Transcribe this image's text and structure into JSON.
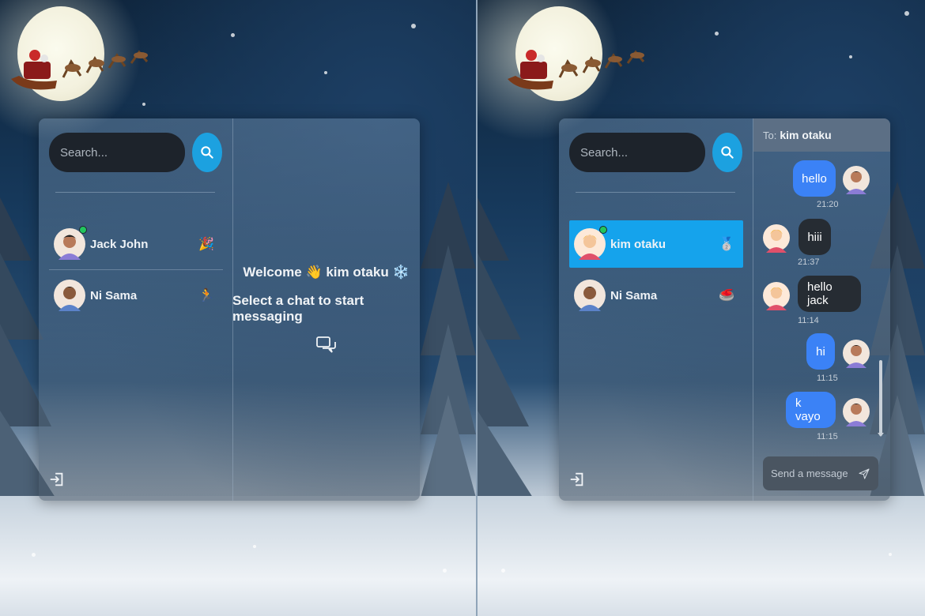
{
  "colors": {
    "accent": "#15a3ec",
    "outgoing_bubble": "#3b82f6",
    "incoming_bubble": "#262c33",
    "online": "#22c55e"
  },
  "left_panel": {
    "search_placeholder": "Search...",
    "conversations": [
      {
        "name": "Jack John",
        "emoji": "🎉",
        "online": true
      },
      {
        "name": "Ni Sama",
        "emoji": "🏃",
        "online": false
      }
    ],
    "welcome": {
      "prefix": "Welcome",
      "wave_emoji": "👋",
      "username": "kim otaku",
      "snow_emoji": "❄️",
      "subtitle": "Select a chat to start messaging"
    }
  },
  "right_panel": {
    "search_placeholder": "Search...",
    "conversations": [
      {
        "name": "kim otaku",
        "emoji": "🥈",
        "online": true,
        "active": true
      },
      {
        "name": "Ni Sama",
        "emoji": "🥌",
        "online": false,
        "active": false
      }
    ],
    "to_label": "To:",
    "recipient": "kim otaku",
    "messages": [
      {
        "text": "hello",
        "time": "21:20",
        "from_me": true
      },
      {
        "text": "hiii",
        "time": "21:37",
        "from_me": false
      },
      {
        "text": "hello jack",
        "time": "11:14",
        "from_me": false
      },
      {
        "text": "hi",
        "time": "11:15",
        "from_me": true
      },
      {
        "text": "k vayo",
        "time": "11:15",
        "from_me": true
      }
    ],
    "message_placeholder": "Send a message"
  }
}
